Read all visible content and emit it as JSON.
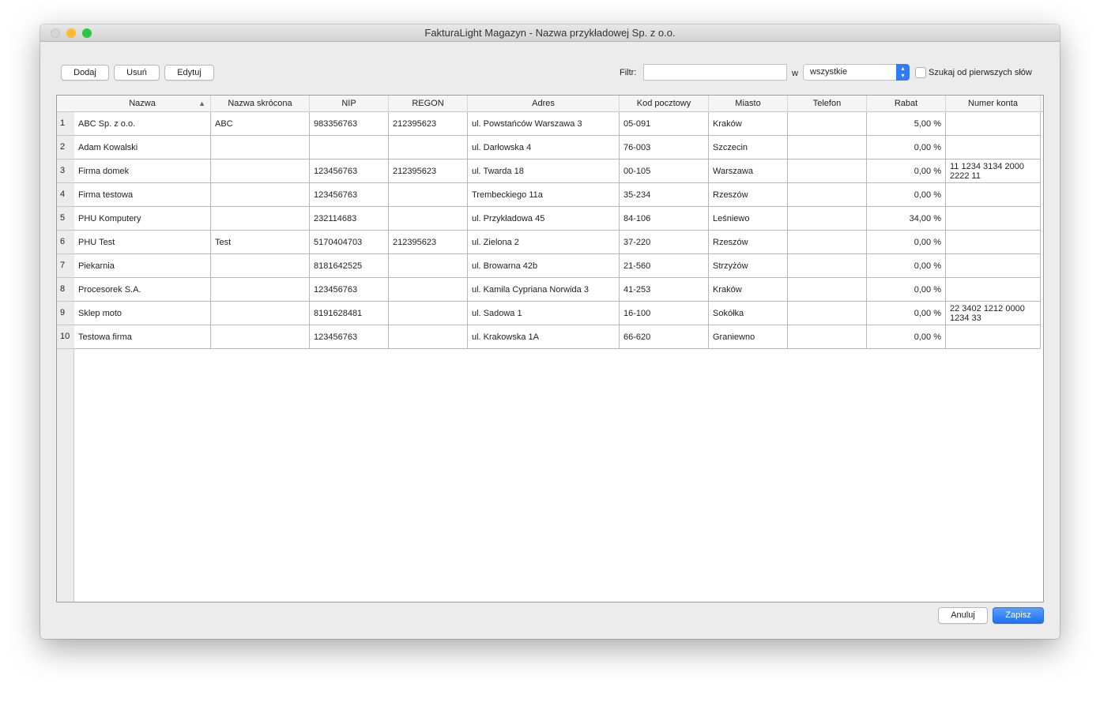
{
  "window": {
    "title": "FakturaLight Magazyn - Nazwa przykładowej Sp. z o.o."
  },
  "toolbar": {
    "add": "Dodaj",
    "remove": "Usuń",
    "edit": "Edytuj",
    "filter_label": "Filtr:",
    "filter_value": "",
    "in_label": "w",
    "scope_value": "wszystkie",
    "prefix_search_label": "Szukaj od pierwszych słów",
    "prefix_search_checked": false
  },
  "table": {
    "columns": [
      "Nazwa",
      "Nazwa skrócona",
      "NIP",
      "REGON",
      "Adres",
      "Kod pocztowy",
      "Miasto",
      "Telefon",
      "Rabat",
      "Numer konta"
    ],
    "sort": {
      "column": "Nazwa",
      "direction": "ascending",
      "icon": "triangle-up-icon"
    },
    "rows": [
      [
        "1",
        "ABC Sp. z o.o.",
        "ABC",
        "983356763",
        "212395623",
        "ul. Powstańców Warszawa 3",
        "05-091",
        "Kraków",
        "",
        "5,00 %",
        ""
      ],
      [
        "2",
        "Adam Kowalski",
        "",
        "",
        "",
        "ul. Darłowska 4",
        "76-003",
        "Szczecin",
        "",
        "0,00 %",
        ""
      ],
      [
        "3",
        "Firma domek",
        "",
        "123456763",
        "212395623",
        "ul. Twarda 18",
        "00-105",
        "Warszawa",
        "",
        "0,00 %",
        "11 1234 3134 2000\n2222 11"
      ],
      [
        "4",
        "Firma testowa",
        "",
        "123456763",
        "",
        "Trembeckiego 11a",
        "35-234",
        "Rzeszów",
        "",
        "0,00 %",
        ""
      ],
      [
        "5",
        "PHU Komputery",
        "",
        "232114683",
        "",
        "ul. Przykładowa 45",
        "84-106",
        "Leśniewo",
        "",
        "34,00 %",
        ""
      ],
      [
        "6",
        "PHU Test",
        "Test",
        "5170404703",
        "212395623",
        "ul. Zielona 2",
        "37-220",
        "Rzeszów",
        "",
        "0,00 %",
        ""
      ],
      [
        "7",
        "Piekarnia",
        "",
        "8181642525",
        "",
        "ul. Browarna 42b",
        "21-560",
        "Strzyżów",
        "",
        "0,00 %",
        ""
      ],
      [
        "8",
        "Procesorek S.A.",
        "",
        "123456763",
        "",
        "ul. Kamila Cypriana Norwida 3",
        "41-253",
        "Kraków",
        "",
        "0,00 %",
        ""
      ],
      [
        "9",
        "Sklep moto",
        "",
        "8191628481",
        "",
        "ul. Sadowa 1",
        "16-100",
        "Sokółka",
        "",
        "0,00 %",
        "22 3402 1212 0000\n1234 33"
      ],
      [
        "10",
        "Testowa firma",
        "",
        "123456763",
        "",
        "ul. Krakowska 1A",
        "66-620",
        "Graniewno",
        "",
        "0,00 %",
        ""
      ]
    ]
  },
  "footer": {
    "cancel": "Anuluj",
    "save": "Zapisz"
  },
  "colors": {
    "accent": "#2f7cf6",
    "close": "#d0d0d0",
    "minimize": "#fdbc2e",
    "maximize": "#28c840"
  }
}
